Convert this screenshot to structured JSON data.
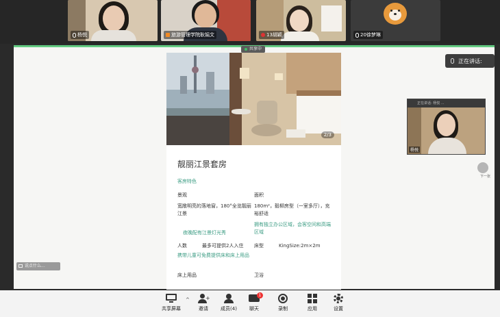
{
  "participants": [
    {
      "name": "杨悦"
    },
    {
      "name": "旅游管理学院耿娟文"
    },
    {
      "name": "13胡颖"
    },
    {
      "name": "20徐梦琳"
    }
  ],
  "share": {
    "badge_label": "共享中"
  },
  "speaking": {
    "label": "正在讲话:"
  },
  "self_video": {
    "name": "杨悦",
    "bar_text": "正在讲话: 杨悦 ..."
  },
  "card": {
    "photo_counter": "2/3",
    "title": "靓丽江景套房",
    "section_title": "客房特色",
    "fields": {
      "view_label": "景观",
      "view_value": "宽敞明亮的落地窗，180°全览靓丽江景",
      "view_note": "夜晚配有江景灯光秀",
      "area_label": "面积",
      "area_value": "180m²，毅柳房型（一室多厅），充裕舒适",
      "area_note": "拥有独立办公区域，会客空间和高端区域",
      "people_label": "人数",
      "people_value": "最多可提供2人入住",
      "people_note": "携带儿童可免费提供床和床上用品",
      "bed_label": "床型",
      "bed_value": "KingSize:2m×2m",
      "bedding_label": "床上用品",
      "bath_label": "卫浴"
    }
  },
  "next": {
    "label": "下一张"
  },
  "chat_chip": {
    "label": "说点什么..."
  },
  "toolbar": {
    "items": [
      {
        "label": "共享屏幕",
        "icon": "share-screen-icon"
      },
      {
        "label": "邀请",
        "icon": "invite-icon"
      },
      {
        "label": "成员(4)",
        "icon": "members-icon"
      },
      {
        "label": "聊天",
        "icon": "chat-icon",
        "badge": "1"
      },
      {
        "label": "录制",
        "icon": "record-icon"
      },
      {
        "label": "应用",
        "icon": "apps-icon"
      },
      {
        "label": "设置",
        "icon": "settings-icon"
      }
    ]
  },
  "colors": {
    "accent_green": "#3fbf64",
    "teal_text": "#3a9b82",
    "badge_red": "#e33333"
  }
}
